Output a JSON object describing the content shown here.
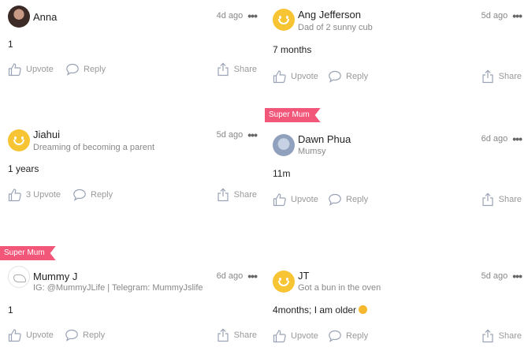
{
  "labels": {
    "upvote": "Upvote",
    "reply": "Reply",
    "share": "Share",
    "more": "•••"
  },
  "colors": {
    "badge": "#f2577a",
    "avatar_yellow": "#f7c534"
  },
  "comments": [
    {
      "name": "Anna",
      "tagline": "",
      "time": "4d ago",
      "body": "1",
      "upvote_label": "Upvote",
      "avatar": "photo",
      "badge": ""
    },
    {
      "name": "Ang Jefferson",
      "tagline": "Dad of 2 sunny cub",
      "time": "5d ago",
      "body": "7 months",
      "upvote_label": "Upvote",
      "avatar": "smiley",
      "badge": ""
    },
    {
      "name": "Jiahui",
      "tagline": "Dreaming of becoming a parent",
      "time": "5d ago",
      "body": "1 years",
      "upvote_label": "3 Upvote",
      "avatar": "smiley",
      "badge": ""
    },
    {
      "name": "Dawn Phua",
      "tagline": "Mumsy",
      "time": "6d ago",
      "body": "11m",
      "upvote_label": "Upvote",
      "avatar": "moon",
      "badge": "Super Mum"
    },
    {
      "name": "Mummy J",
      "tagline": "IG: @MummyJLife | Telegram: MummyJslife",
      "time": "6d ago",
      "body": "1",
      "upvote_label": "Upvote",
      "avatar": "sketch",
      "badge": "Super Mum"
    },
    {
      "name": "JT",
      "tagline": "Got a bun in the oven",
      "time": "5d ago",
      "body": "4months; I am older",
      "upvote_label": "Upvote",
      "avatar": "smiley",
      "badge": ""
    }
  ]
}
